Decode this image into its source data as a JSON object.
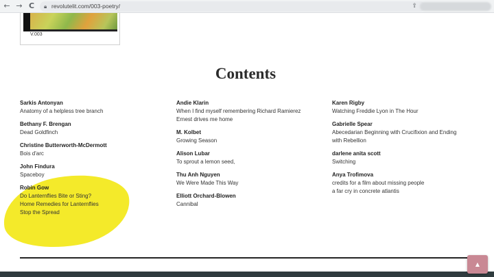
{
  "browser": {
    "url": "revolutelit.com/003-poetry/",
    "back_icon": "←",
    "forward_icon": "→",
    "reload_icon": "C"
  },
  "cover": {
    "label": "V.003"
  },
  "heading": "Contents",
  "columns": [
    [
      {
        "author": "Sarkis Antonyan",
        "titles": [
          "Anatomy of a helpless tree branch"
        ]
      },
      {
        "author": "Bethany F. Brengan",
        "titles": [
          "Dead Goldfinch"
        ]
      },
      {
        "author": "Christine Butterworth-McDermott",
        "titles": [
          "Bois d'arc"
        ]
      },
      {
        "author": "John Findura",
        "titles": [
          "Spaceboy"
        ]
      },
      {
        "author": "Robin Gow",
        "titles": [
          "Do Lanternflies Bite or Sting?",
          "Home Remedies for Lanternflies",
          "Stop the Spread"
        ]
      }
    ],
    [
      {
        "author": "Andie Klarin",
        "titles": [
          "When I find myself remembering Richard Ramierez",
          "Ernest drives me home"
        ]
      },
      {
        "author": "M. Kolbet",
        "titles": [
          "Growing Season"
        ]
      },
      {
        "author": "Alison Lubar",
        "titles": [
          "To sprout a lemon seed,"
        ]
      },
      {
        "author": "Thu Anh Nguyen",
        "titles": [
          "We Were Made This Way"
        ]
      },
      {
        "author": "Elliott Orchard-Blowen",
        "titles": [
          "Cannibal"
        ]
      }
    ],
    [
      {
        "author": "Karen Rigby",
        "titles": [
          "Watching Freddie Lyon in The Hour"
        ]
      },
      {
        "author": "Gabrielle Spear",
        "titles": [
          "Abecedarian Beginning with Crucifixion and Ending",
          "with Rebellion"
        ]
      },
      {
        "author": "darlene anita scott",
        "titles": [
          "Switching"
        ]
      },
      {
        "author": "Anya Trofimova",
        "titles": [
          "credits for a film about missing people",
          "a far cry in concrete atlantis"
        ]
      }
    ]
  ],
  "back_to_top": "▲",
  "colors": {
    "highlight": "#f4ea2a",
    "footer": "#2f3b3e",
    "back_to_top": "#c98894"
  }
}
